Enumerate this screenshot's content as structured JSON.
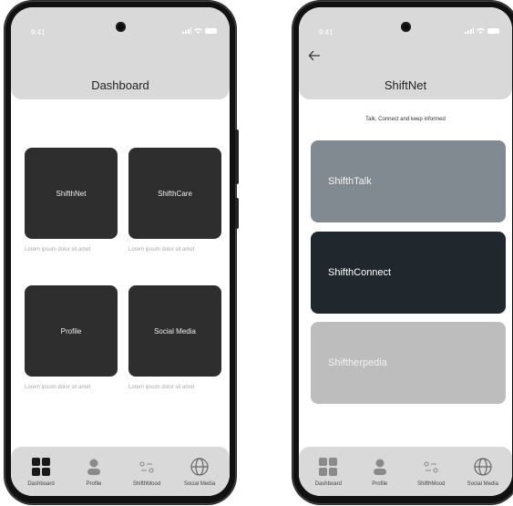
{
  "colors": {
    "header_bg": "#d9d9d9",
    "tile_dark": "#2e2e2e",
    "card_talk": "#818a91",
    "card_connect": "#20272d",
    "card_pedia": "#bdbdbd"
  },
  "status": {
    "time": "9:41"
  },
  "dashboard": {
    "title": "Dashboard",
    "tiles": [
      {
        "label": "ShifthNet",
        "caption": "Lorem ipsum dolor sit amet"
      },
      {
        "label": "ShifthCare",
        "caption": "Lorem ipsum dolor sit amet"
      },
      {
        "label": "Profile",
        "caption": "Lorem ipsum dolor sit amet"
      },
      {
        "label": "Social Media",
        "caption": "Lorem ipsum dolor sit amet"
      }
    ]
  },
  "shiftnet": {
    "title": "ShiftNet",
    "subtitle": "Talk, Connect and keep informed",
    "cards": [
      {
        "label": "ShifthTalk"
      },
      {
        "label": "ShifthConnect"
      },
      {
        "label": "Shiftherpedia"
      }
    ]
  },
  "nav": [
    {
      "label": "Dashboard",
      "icon": "grid-icon"
    },
    {
      "label": "Profile",
      "icon": "person-icon"
    },
    {
      "label": "ShifthMood",
      "icon": "sliders-icon"
    },
    {
      "label": "Social Media",
      "icon": "globe-icon"
    }
  ]
}
